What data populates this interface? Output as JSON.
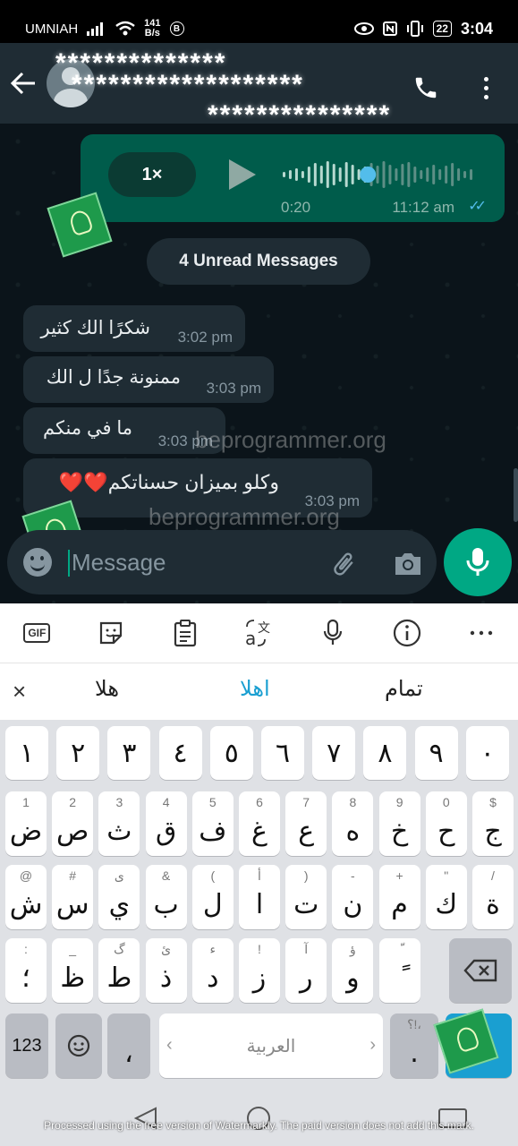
{
  "status": {
    "carrier": "UMNIAH",
    "net_speed_top": "141",
    "net_speed_bottom": "B/s",
    "b_badge": "B",
    "battery": "22",
    "time": "3:04"
  },
  "header": {
    "contact_name": "**************",
    "contact_line2": "*******************",
    "contact_line3": "***************"
  },
  "voice": {
    "speed": "1×",
    "duration": "0:20",
    "time": "11:12 am",
    "progress": 0.45
  },
  "unread_label": "4 Unread Messages",
  "messages": [
    {
      "text": "شكرًا الك كثير",
      "time": "3:02 pm"
    },
    {
      "text": "ممنونة جدًا ل الك",
      "time": "3:03 pm"
    },
    {
      "text": "ما في منكم",
      "time": "3:03 pm"
    },
    {
      "text": "وكلو بميزان حسناتكم❤️❤️",
      "time": "3:03 pm"
    }
  ],
  "watermark_text": "beprogrammer.org",
  "input": {
    "placeholder": "Message"
  },
  "keyboard": {
    "suggestions": [
      "هلا",
      "اهلا",
      "تمام"
    ],
    "num_row": [
      "١",
      "٢",
      "٣",
      "٤",
      "٥",
      "٦",
      "٧",
      "٨",
      "٩",
      "٠"
    ],
    "row1": [
      {
        "sub": "1",
        "main": "ض"
      },
      {
        "sub": "2",
        "main": "ص"
      },
      {
        "sub": "3",
        "main": "ث"
      },
      {
        "sub": "4",
        "main": "ق"
      },
      {
        "sub": "5",
        "main": "ف"
      },
      {
        "sub": "6",
        "main": "غ"
      },
      {
        "sub": "7",
        "main": "ع"
      },
      {
        "sub": "8",
        "main": "ه"
      },
      {
        "sub": "9",
        "main": "خ"
      },
      {
        "sub": "0",
        "main": "ح"
      },
      {
        "sub": "$",
        "main": "ج"
      }
    ],
    "row2": [
      {
        "sub": "@",
        "main": "ش"
      },
      {
        "sub": "#",
        "main": "س"
      },
      {
        "sub": "ى",
        "main": "ي"
      },
      {
        "sub": "&",
        "main": "ب"
      },
      {
        "sub": "(",
        "main": "ل"
      },
      {
        "sub": "أ",
        "main": "ا"
      },
      {
        "sub": ")",
        "main": "ت"
      },
      {
        "sub": "-",
        "main": "ن"
      },
      {
        "sub": "+",
        "main": "م"
      },
      {
        "sub": "\"",
        "main": "ك"
      },
      {
        "sub": "/",
        "main": "ة"
      }
    ],
    "row3": [
      {
        "sub": ":",
        "main": "؛"
      },
      {
        "sub": "_",
        "main": "ظ"
      },
      {
        "sub": "گ",
        "main": "ط"
      },
      {
        "sub": "ئ",
        "main": "ذ"
      },
      {
        "sub": "ء",
        "main": "د"
      },
      {
        "sub": "!",
        "main": "ز"
      },
      {
        "sub": "آ",
        "main": "ر"
      },
      {
        "sub": "ؤ",
        "main": "و"
      },
      {
        "sub": "ّ",
        "main": "ً"
      }
    ],
    "key_123": "123",
    "key_comma": "،",
    "space_label": "العربية",
    "period_sub": "؟!،",
    "period": "."
  },
  "footer_watermark": "Processed using the free version of Watermarkly. The paid version does not add this mark."
}
